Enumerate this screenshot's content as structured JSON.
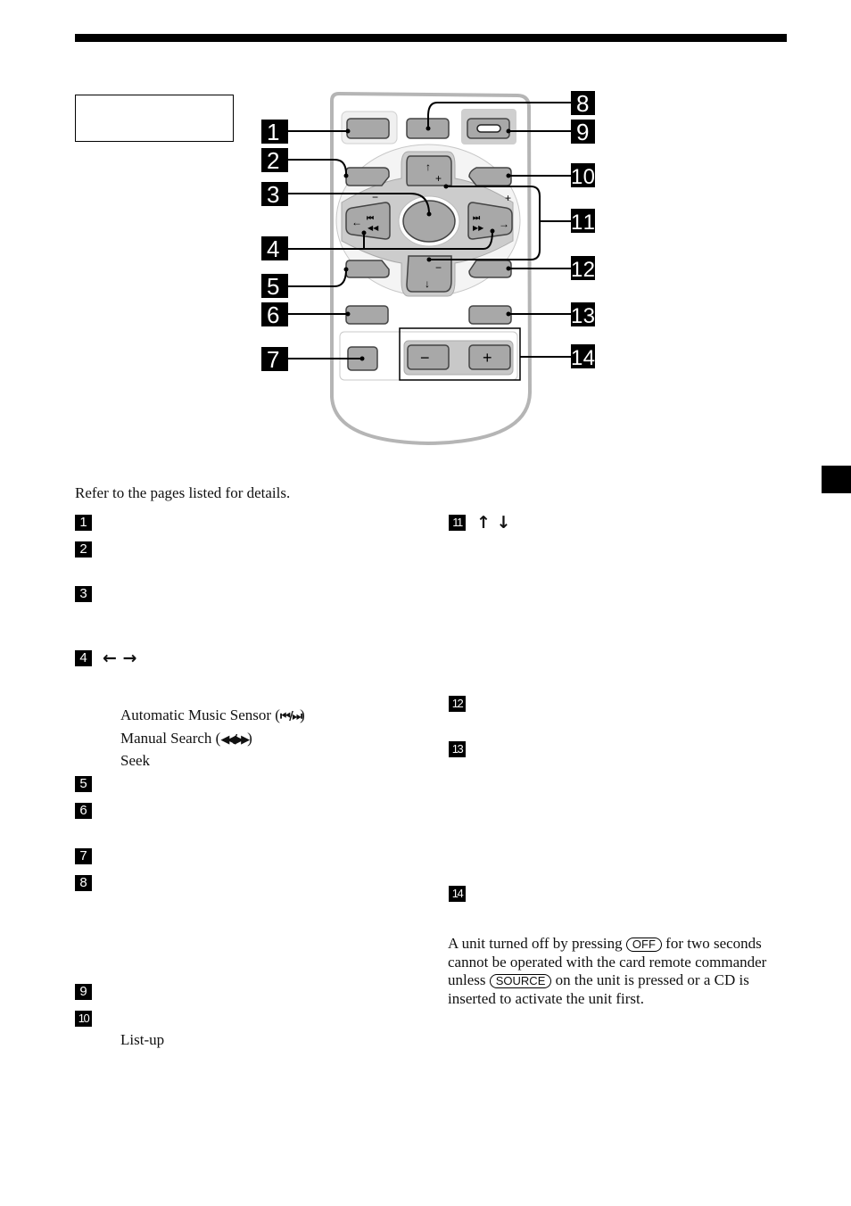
{
  "page": {
    "intro": "Refer to the pages listed for details.",
    "side_tab_color": "#000000"
  },
  "diagram": {
    "callouts_left": [
      "1",
      "2",
      "3",
      "4",
      "5",
      "6",
      "7"
    ],
    "callouts_right": [
      "8",
      "9",
      "10",
      "11",
      "12",
      "13",
      "14"
    ],
    "button_glyphs": {
      "up": "↑",
      "down": "↓",
      "plus": "+",
      "minus": "−",
      "left_arrow": "←",
      "right_arrow": "→",
      "prev_track": "⏮",
      "rewind": "◀◀",
      "next_track": "⏭",
      "fast_forward": "▶▶",
      "vol_minus": "−",
      "vol_plus": "+"
    },
    "colors": {
      "body": "#e6e6e6",
      "button": "#a8a8a8",
      "pad": "#c8c8c8",
      "outline": "#555555"
    }
  },
  "items_left": [
    {
      "num": "1"
    },
    {
      "num": "2"
    },
    {
      "num": "3"
    },
    {
      "num": "4",
      "symbols": "← →"
    },
    {
      "num": "5"
    },
    {
      "num": "6"
    },
    {
      "num": "7"
    },
    {
      "num": "8"
    },
    {
      "num": "9"
    },
    {
      "num": "10"
    }
  ],
  "item4_sub": {
    "ams_label": "Automatic Music Sensor (",
    "ams_symbols": "⏮ / ⏭",
    "ams_close": ")",
    "ms_label": "Manual Search (",
    "ms_symbols": "◀◀/▶▶",
    "ms_close": ")",
    "seek": "Seek"
  },
  "item10_sub": "List-up",
  "items_right": [
    {
      "num": "11",
      "symbols": "↑ ↓"
    },
    {
      "num": "12"
    },
    {
      "num": "13"
    },
    {
      "num": "14"
    }
  ],
  "note": {
    "part1": "A unit turned off by pressing ",
    "key_off": "OFF",
    "part2": " for two seconds cannot be operated with the card remote commander unless ",
    "key_source": "SOURCE",
    "part3": " on the unit is pressed or a CD is inserted to activate the unit first."
  }
}
